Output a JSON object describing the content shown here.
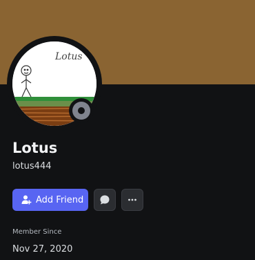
{
  "profile": {
    "banner_color": "#8a6432",
    "display_name": "Lotus",
    "username": "lotus444",
    "avatar_text": "Lotus",
    "status": "offline"
  },
  "actions": {
    "add_friend_label": "Add Friend",
    "add_friend_icon": "person-add-icon",
    "message_icon": "chat-bubble-icon",
    "more_icon": "more-horizontal-icon"
  },
  "member_since": {
    "label": "Member Since",
    "value": "Nov 27, 2020"
  },
  "colors": {
    "accent": "#5865f2",
    "background": "#111214",
    "status_offline": "#80848e"
  }
}
